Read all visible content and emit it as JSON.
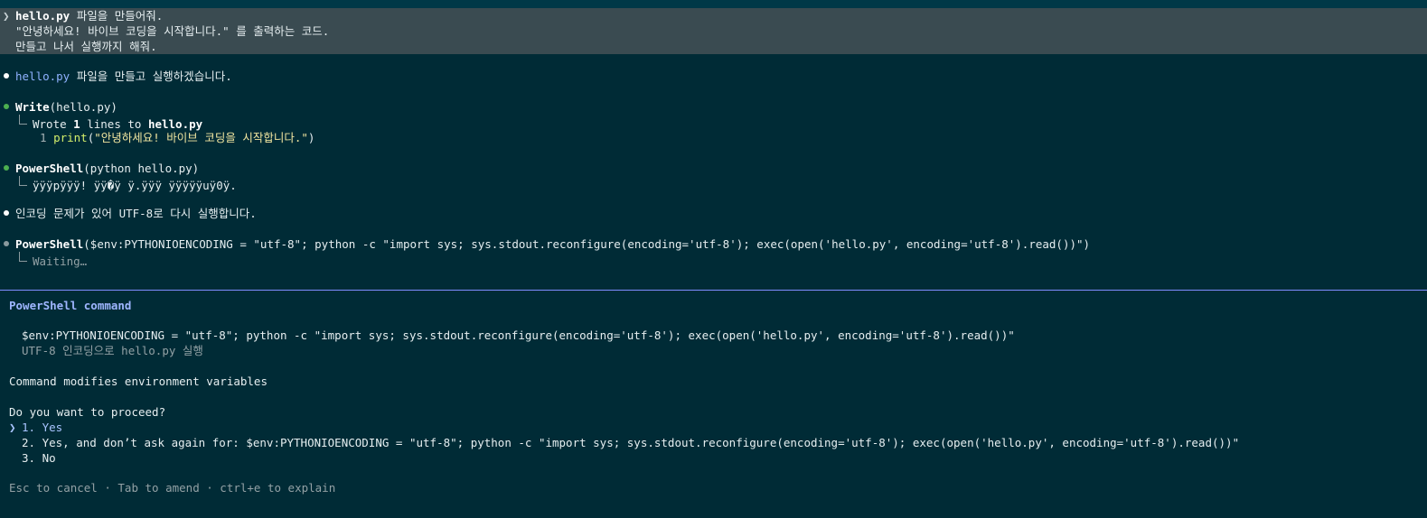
{
  "user_prompt": {
    "caret": "❯",
    "lines": [
      {
        "bold": "hello.py",
        "rest": " 파일을 만들어줘."
      },
      {
        "text": "\"안녕하세요! 바이브 코딩을 시작합니다.\" 를 출력하는 코드."
      },
      {
        "text": "만들고 나서 실행까지 해줘."
      }
    ]
  },
  "assistant": {
    "intro": {
      "file": "hello.py",
      "rest": " 파일을 만들고 실행하겠습니다."
    },
    "write": {
      "tool": "Write",
      "arg": "(hello.py)",
      "result_prefix": "Wrote ",
      "result_count": "1",
      "result_mid": " lines to ",
      "result_file": "hello.py",
      "code_line_num": "1",
      "code_fn": "print",
      "code_open": "(",
      "code_str": "\"안녕하세요! 바이브 코딩을 시작합니다.\"",
      "code_close": ")"
    },
    "ps1": {
      "tool": "PowerShell",
      "arg": "(python hello.py)",
      "output": "ÿÿÿpÿÿÿ! ÿÿ�ÿ ÿ.ÿÿÿ ÿÿÿÿÿuÿ0ÿ."
    },
    "note": {
      "pre": "인코딩 문제가 있어 ",
      "code": "UTF-8",
      "post": "로 다시 실행합니다."
    },
    "ps2": {
      "tool": "PowerShell",
      "arg": "($env:PYTHONIOENCODING = \"utf-8\"; python -c \"import sys; sys.stdout.reconfigure(encoding='utf-8'); exec(open('hello.py', encoding='utf-8').read())\")",
      "status": "Waiting…"
    }
  },
  "panel": {
    "title": "PowerShell command",
    "command": "$env:PYTHONIOENCODING = \"utf-8\"; python -c \"import sys; sys.stdout.reconfigure(encoding='utf-8'); exec(open('hello.py', encoding='utf-8').read())\"",
    "description": "UTF-8 인코딩으로 hello.py 실행",
    "warning": "Command modifies environment variables",
    "question": "Do you want to proceed?",
    "selected_caret": "❯",
    "options": [
      "1. Yes",
      "2. Yes, and don’t ask again for: $env:PYTHONIOENCODING = \"utf-8\"; python -c \"import sys; sys.stdout.reconfigure(encoding='utf-8'); exec(open('hello.py', encoding='utf-8').read())\"",
      "3. No"
    ],
    "footer": "Esc to cancel · Tab to amend · ctrl+e to explain"
  },
  "colors": {
    "background": "#002b36",
    "user_block": "#3a4b51",
    "divider": "#7f8dff",
    "success_bullet": "#4caf50",
    "accent_blue": "#9fb6ff"
  }
}
